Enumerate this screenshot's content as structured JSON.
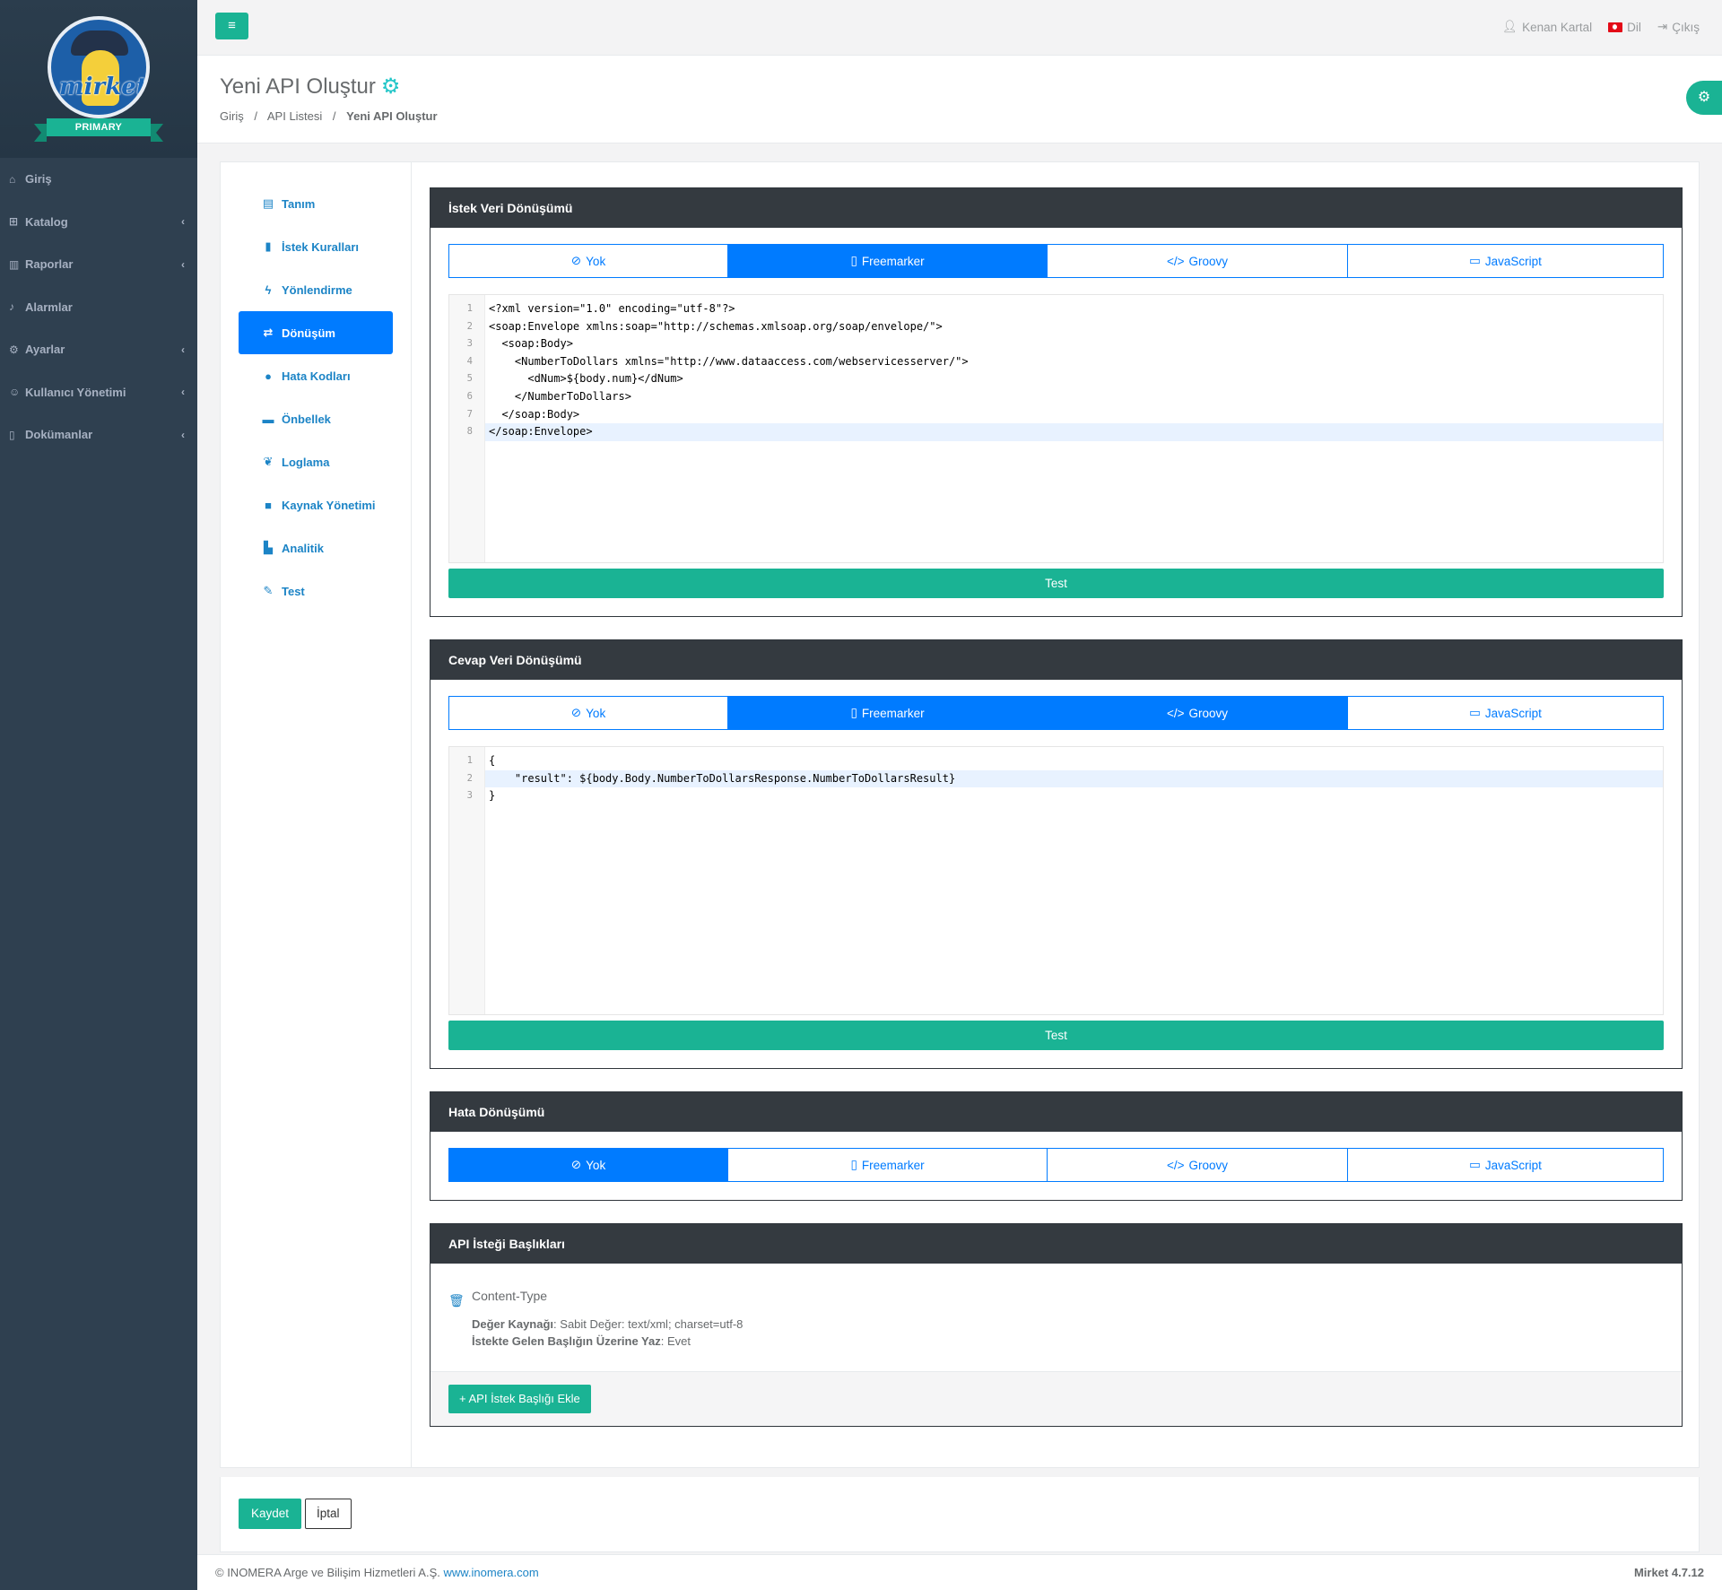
{
  "brand": {
    "logo_text": "mirket",
    "ribbon": "PRIMARY"
  },
  "sidebar": {
    "items": [
      {
        "label": "Giriş",
        "icon": "home-icon",
        "has_children": false
      },
      {
        "label": "Katalog",
        "icon": "sitemap-icon",
        "has_children": true
      },
      {
        "label": "Raporlar",
        "icon": "chart-icon",
        "has_children": true
      },
      {
        "label": "Alarmlar",
        "icon": "bell-icon",
        "has_children": false
      },
      {
        "label": "Ayarlar",
        "icon": "cogs-icon",
        "has_children": true
      },
      {
        "label": "Kullanıcı Yönetimi",
        "icon": "users-icon",
        "has_children": true
      },
      {
        "label": "Dokümanlar",
        "icon": "file-icon",
        "has_children": true
      }
    ]
  },
  "topbar": {
    "user": "Kenan Kartal",
    "language": "Dil",
    "logout": "Çıkış"
  },
  "heading": {
    "title": "Yeni API Oluştur",
    "breadcrumb": [
      "Giriş",
      "API Listesi",
      "Yeni API Oluştur"
    ]
  },
  "subnav": {
    "items": [
      {
        "label": "Tanım",
        "icon": "id-card-icon"
      },
      {
        "label": "İstek Kuralları",
        "icon": "book-icon"
      },
      {
        "label": "Yönlendirme",
        "icon": "bolt-icon"
      },
      {
        "label": "Dönüşüm",
        "icon": "exchange-icon",
        "active": true
      },
      {
        "label": "Hata Kodları",
        "icon": "exclamation-icon"
      },
      {
        "label": "Önbellek",
        "icon": "memory-icon"
      },
      {
        "label": "Loglama",
        "icon": "leaf-icon"
      },
      {
        "label": "Kaynak Yönetimi",
        "icon": "lock-icon"
      },
      {
        "label": "Analitik",
        "icon": "chart-icon"
      },
      {
        "label": "Test",
        "icon": "pencil-icon"
      }
    ]
  },
  "transform_tabs": [
    "Yok",
    "Freemarker",
    "Groovy",
    "JavaScript"
  ],
  "request_panel": {
    "title": "İstek Veri Dönüşümü",
    "active_tab": "Freemarker",
    "lines": [
      "<?xml version=\"1.0\" encoding=\"utf-8\"?>",
      "<soap:Envelope xmlns:soap=\"http://schemas.xmlsoap.org/soap/envelope/\">",
      "  <soap:Body>",
      "    <NumberToDollars xmlns=\"http://www.dataaccess.com/webservicesserver/\">",
      "      <dNum>${body.num}</dNum>",
      "    </NumberToDollars>",
      "  </soap:Body>",
      "</soap:Envelope>"
    ],
    "test_label": "Test"
  },
  "response_panel": {
    "title": "Cevap Veri Dönüşümü",
    "active_tabs": [
      "Freemarker",
      "Groovy"
    ],
    "lines": [
      "{",
      "    \"result\": ${body.Body.NumberToDollarsResponse.NumberToDollarsResult}",
      "}"
    ],
    "test_label": "Test"
  },
  "error_panel": {
    "title": "Hata Dönüşümü",
    "active_tab": "Yok"
  },
  "headers_panel": {
    "title": "API İsteği Başlıkları",
    "header_name": "Content-Type",
    "value_source_label": "Değer Kaynağı",
    "value_source": "Sabit Değer: text/xml; charset=utf-8",
    "override_label": "İstekte Gelen Başlığın Üzerine Yaz",
    "override_value": "Evet",
    "add_button": "API İstek Başlığı Ekle"
  },
  "actions": {
    "save": "Kaydet",
    "cancel": "İptal"
  },
  "footer": {
    "copyright": "© INOMERA Arge ve Bilişim Hizmetleri A.Ş.",
    "link": "www.inomera.com",
    "version": "Mirket 4.7.12"
  },
  "colors": {
    "accent": "#1ab394",
    "primary": "#007bff",
    "sidebar": "#2f4050",
    "panel_head": "#343a40"
  }
}
